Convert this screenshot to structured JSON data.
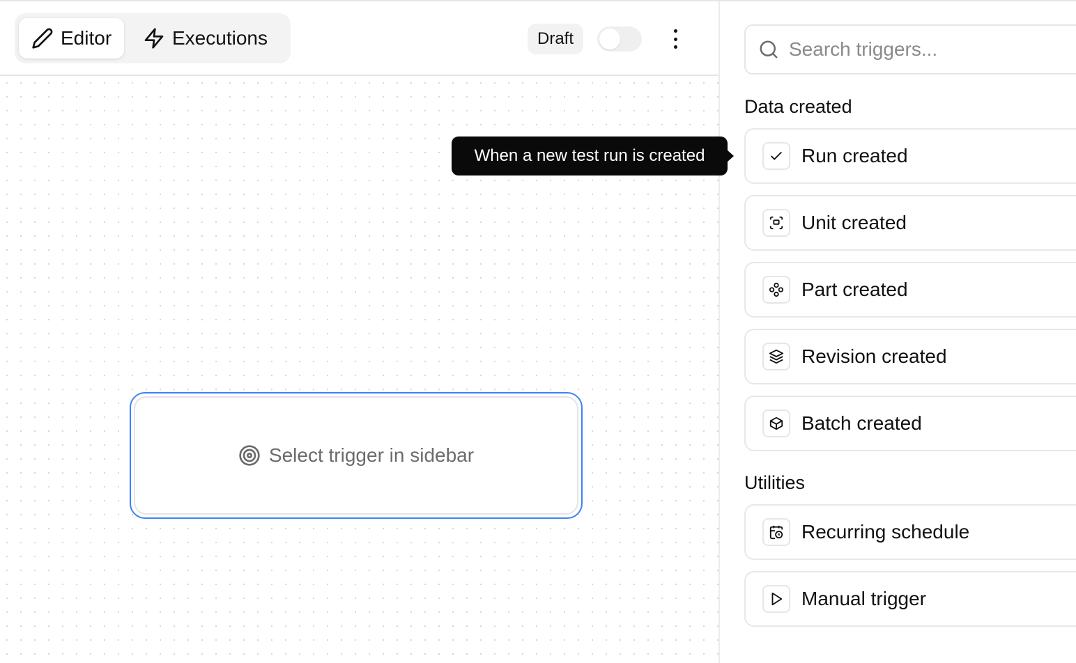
{
  "header": {
    "tabs": [
      {
        "label": "Editor",
        "icon": "pencil-icon",
        "active": true
      },
      {
        "label": "Executions",
        "icon": "lightning-icon",
        "active": false
      }
    ],
    "status": "Draft",
    "toggle_on": false
  },
  "canvas": {
    "node_label": "Select trigger in sidebar",
    "tooltip": "When a new test run is created"
  },
  "sidebar": {
    "search_placeholder": "Search triggers...",
    "sections": [
      {
        "title": "Data created",
        "items": [
          {
            "label": "Run created",
            "icon": "check-icon"
          },
          {
            "label": "Unit created",
            "icon": "scan-icon"
          },
          {
            "label": "Part created",
            "icon": "components-icon"
          },
          {
            "label": "Revision created",
            "icon": "layers-icon"
          },
          {
            "label": "Batch created",
            "icon": "package-icon"
          }
        ]
      },
      {
        "title": "Utilities",
        "items": [
          {
            "label": "Recurring schedule",
            "icon": "calendar-clock-icon"
          },
          {
            "label": "Manual trigger",
            "icon": "play-icon"
          }
        ]
      }
    ]
  },
  "colors": {
    "accent": "#3b82f6",
    "tooltip_bg": "#0a0a0a"
  }
}
